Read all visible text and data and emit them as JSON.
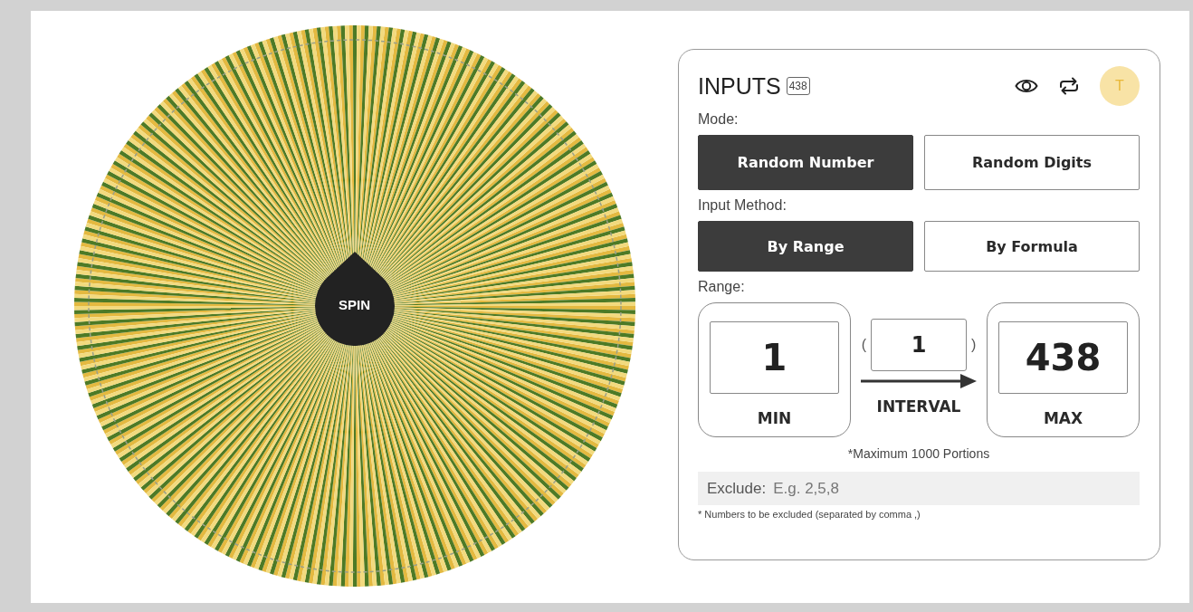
{
  "wheel": {
    "spin_label": "SPIN"
  },
  "panel": {
    "title": "INPUTS",
    "count_badge": "438",
    "avatar_letter": "T",
    "mode": {
      "label": "Mode:",
      "options": [
        {
          "label": "Random Number",
          "selected": true
        },
        {
          "label": "Random Digits",
          "selected": false
        }
      ]
    },
    "input_method": {
      "label": "Input Method:",
      "options": [
        {
          "label": "By Range",
          "selected": true
        },
        {
          "label": "By Formula",
          "selected": false
        }
      ]
    },
    "range": {
      "label": "Range:",
      "min": {
        "value": "1",
        "caption": "MIN"
      },
      "interval": {
        "value": "1",
        "caption": "INTERVAL",
        "open_paren": "(",
        "close_paren": ")"
      },
      "max": {
        "value": "438",
        "caption": "MAX"
      }
    },
    "range_note": "*Maximum 1000 Portions",
    "exclude": {
      "label": "Exclude:",
      "placeholder": "E.g. 2,5,8"
    },
    "exclude_note": "* Numbers to be excluded (separated by comma ,)"
  }
}
